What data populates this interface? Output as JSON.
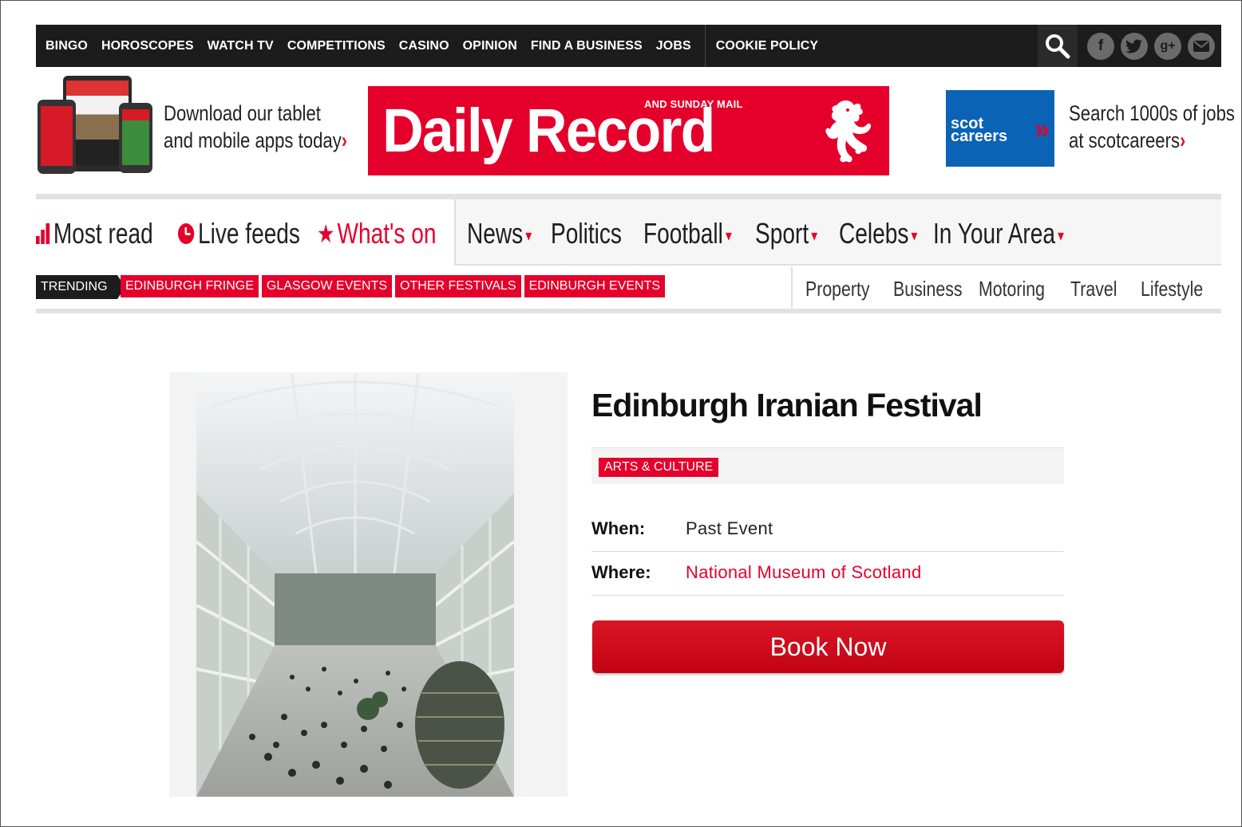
{
  "topbar": {
    "links": [
      "BINGO",
      "HOROSCOPES",
      "WATCH TV",
      "COMPETITIONS",
      "CASINO",
      "OPINION",
      "FIND A BUSINESS",
      "JOBS"
    ],
    "cookie": "COOKIE POLICY",
    "socials": [
      "facebook-icon",
      "twitter-icon",
      "google-plus-icon",
      "email-icon"
    ]
  },
  "masthead": {
    "apps_line1": "Download our tablet",
    "apps_line2": "and mobile apps today",
    "logo_sub": "AND SUNDAY MAIL",
    "logo_main": "Daily Record",
    "careers_line1": "scot",
    "careers_line2": "careers",
    "jobs_line1": "Search 1000s of jobs",
    "jobs_line2": "at scotcareers"
  },
  "mainnav": {
    "quick": [
      "Most read",
      "Live feeds",
      "What's on"
    ],
    "sections": [
      "News",
      "Politics",
      "Football",
      "Sport",
      "Celebs",
      "In Your Area"
    ]
  },
  "trending": {
    "label": "TRENDING",
    "tags": [
      "EDINBURGH FRINGE",
      "GLASGOW EVENTS",
      "OTHER FESTIVALS",
      "EDINBURGH EVENTS"
    ],
    "subnav": [
      "Property",
      "Business",
      "Motoring",
      "Travel",
      "Lifestyle"
    ]
  },
  "event": {
    "title": "Edinburgh Iranian Festival",
    "category": "ARTS & CULTURE",
    "when_label": "When:",
    "when_value": "Past Event",
    "where_label": "Where:",
    "where_value": "National Museum of Scotland",
    "book_label": "Book Now"
  },
  "colors": {
    "brand_red": "#e4002b",
    "dark_bar": "#1c1c1c",
    "careers_blue": "#0a63b4"
  }
}
